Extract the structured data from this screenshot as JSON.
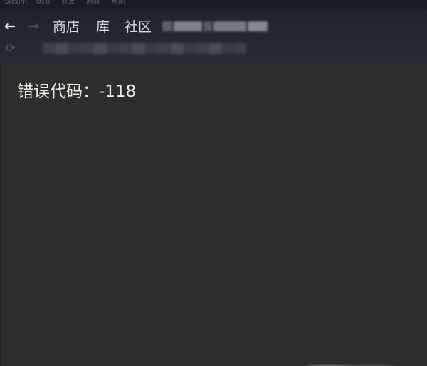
{
  "menu": {
    "items": [
      "Steam",
      "视图",
      "好友",
      "游戏",
      "帮助"
    ]
  },
  "nav": {
    "back_glyph": "←",
    "forward_glyph": "→",
    "reload_glyph": "⟳",
    "tabs": [
      "商店",
      "库",
      "社区"
    ]
  },
  "content": {
    "error_text": "错误代码：-118"
  },
  "colors": {
    "window_bg": "#1b1f27",
    "content_bg": "#2d2d2b",
    "text": "#eceae6"
  }
}
